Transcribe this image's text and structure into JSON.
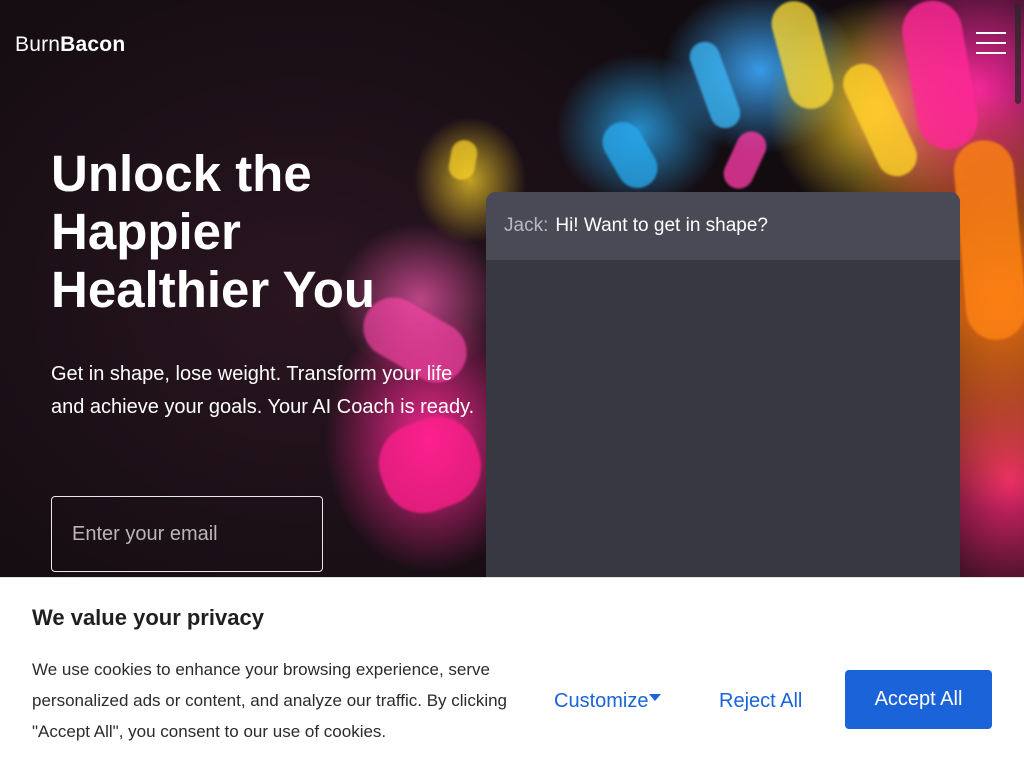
{
  "header": {
    "logo_part1": "Burn",
    "logo_part2": "Bacon",
    "menu_icon": "hamburger-menu-icon"
  },
  "hero": {
    "title_line1": "Unlock the",
    "title_line2": "Happier",
    "title_line3": "Healthier You",
    "subtitle": "Get in shape, lose weight. Transform your life and achieve your goals. Your AI Coach is ready.",
    "email_placeholder": "Enter your email"
  },
  "chat": {
    "messages": [
      {
        "speaker": "Jack:",
        "text": "Hi! Want to get in shape?"
      }
    ]
  },
  "cookie_banner": {
    "title": "We value your privacy",
    "text": "We use cookies to enhance your browsing experience, serve personalized ads or content, and analyze our traffic. By clicking \"Accept All\", you consent to our use of cookies.",
    "customize_label": "Customize",
    "reject_label": "Reject All",
    "accept_label": "Accept All"
  },
  "colors": {
    "accent": "#1a63d9",
    "chat_panel": "#383843",
    "chat_message_bg": "#4a4a57"
  }
}
